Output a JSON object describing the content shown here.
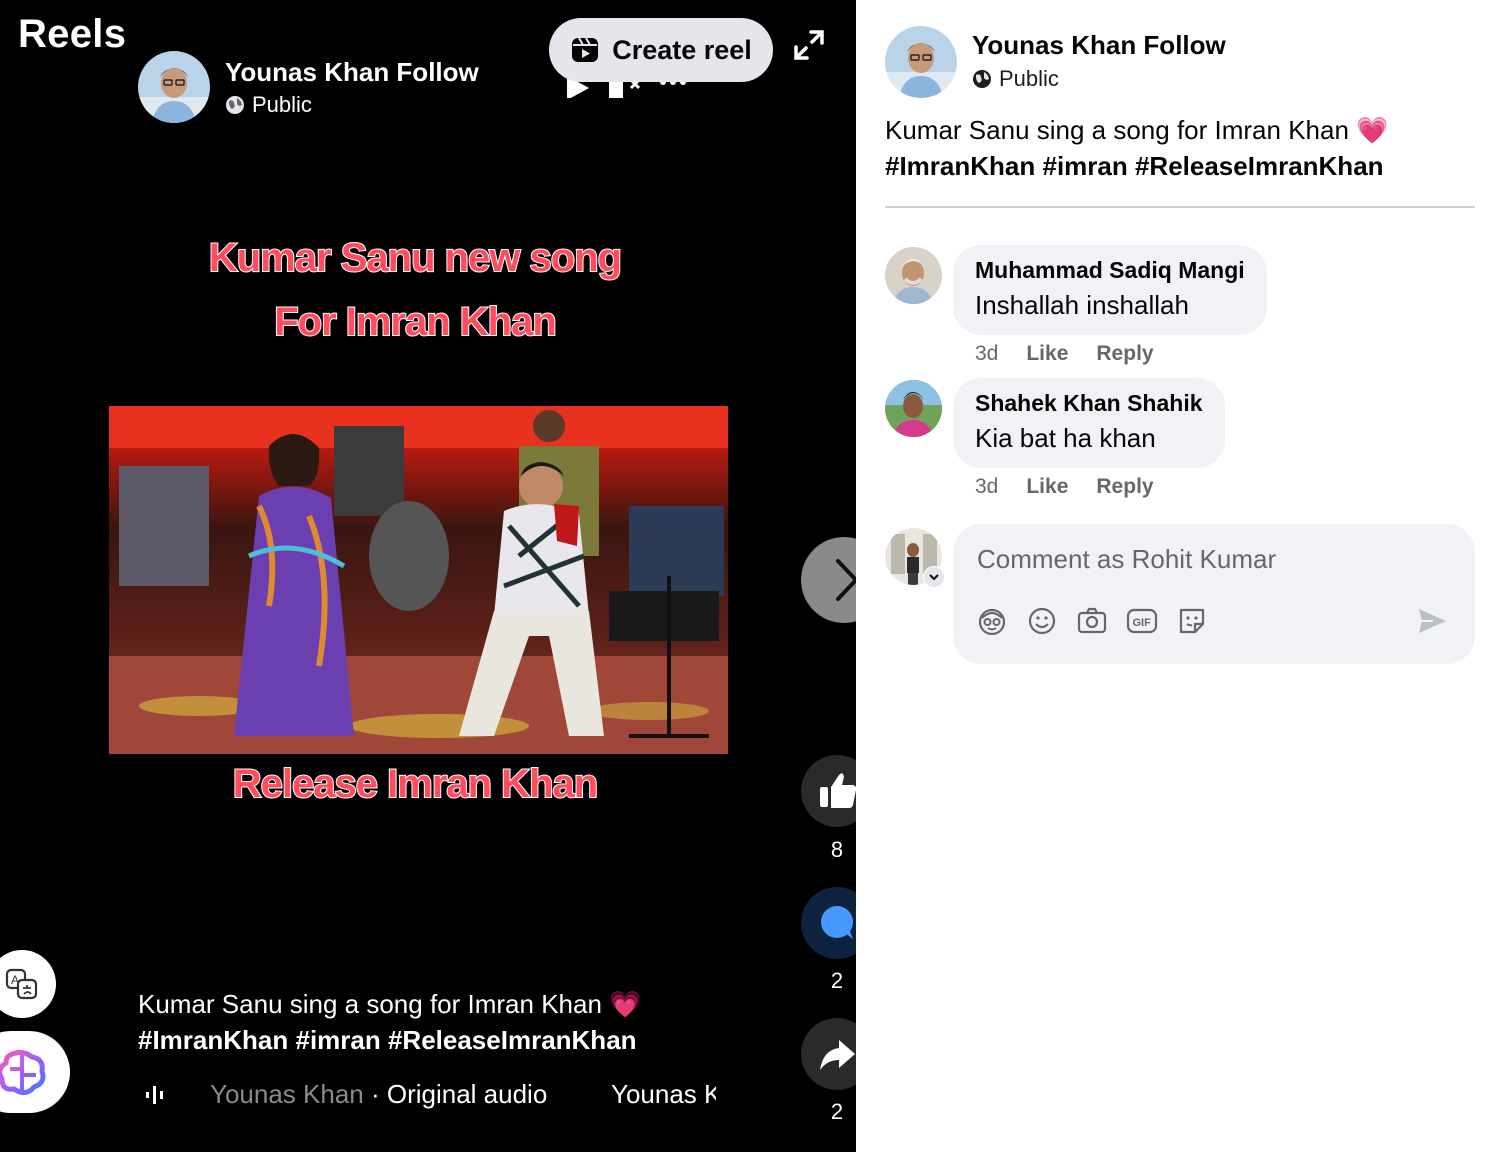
{
  "reel": {
    "title": "Reels",
    "author_name": "Younas Khan Follow",
    "privacy": "Public",
    "create_reel_label": "Create reel",
    "video_text": {
      "line1": "Kumar Sanu new song",
      "line2": "For Imran Khan",
      "line3": "Release Imran Khan"
    },
    "caption_text": "Kumar Sanu sing a song for Imran Khan 💗",
    "caption_tags": "#ImranKhan #imran #ReleaseImranKhan",
    "audio": {
      "author": "Younas Khan",
      "separator": " · ",
      "label": "Original audio",
      "marquee_repeat": "Younas K"
    },
    "likes_count": "8",
    "comments_count": "2",
    "shares_count": "2"
  },
  "panel": {
    "author_name": "Younas Khan Follow",
    "privacy": "Public",
    "caption_text": "Kumar Sanu sing a song for Imran Khan 💗",
    "caption_tags": "#ImranKhan #imran #ReleaseImranKhan",
    "comments": [
      {
        "name": "Muhammad Sadiq Mangi",
        "text": "Inshallah inshallah",
        "time": "3d",
        "like": "Like",
        "reply": "Reply"
      },
      {
        "name": "Shahek Khan Shahik",
        "text": "Kia bat ha khan",
        "time": "3d",
        "like": "Like",
        "reply": "Reply"
      }
    ],
    "composer": {
      "placeholder": "Comment as Rohit Kumar",
      "tools": [
        "avatar-sticker-icon",
        "emoji-icon",
        "camera-icon",
        "gif-icon",
        "sticker-icon"
      ]
    }
  },
  "colors": {
    "accent_blue": "#1877f2",
    "headline_red": "#ff4d5e",
    "bubble_gray": "#f0f2f5",
    "meta_gray": "#65676b"
  }
}
